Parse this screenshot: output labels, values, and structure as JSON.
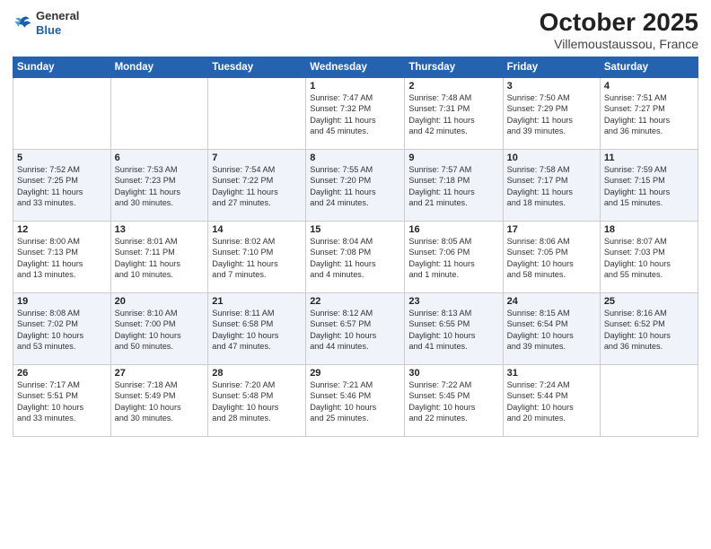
{
  "logo": {
    "general": "General",
    "blue": "Blue"
  },
  "title": "October 2025",
  "location": "Villemoustaussou, France",
  "headers": [
    "Sunday",
    "Monday",
    "Tuesday",
    "Wednesday",
    "Thursday",
    "Friday",
    "Saturday"
  ],
  "weeks": [
    [
      {
        "day": "",
        "info": ""
      },
      {
        "day": "",
        "info": ""
      },
      {
        "day": "",
        "info": ""
      },
      {
        "day": "1",
        "info": "Sunrise: 7:47 AM\nSunset: 7:32 PM\nDaylight: 11 hours\nand 45 minutes."
      },
      {
        "day": "2",
        "info": "Sunrise: 7:48 AM\nSunset: 7:31 PM\nDaylight: 11 hours\nand 42 minutes."
      },
      {
        "day": "3",
        "info": "Sunrise: 7:50 AM\nSunset: 7:29 PM\nDaylight: 11 hours\nand 39 minutes."
      },
      {
        "day": "4",
        "info": "Sunrise: 7:51 AM\nSunset: 7:27 PM\nDaylight: 11 hours\nand 36 minutes."
      }
    ],
    [
      {
        "day": "5",
        "info": "Sunrise: 7:52 AM\nSunset: 7:25 PM\nDaylight: 11 hours\nand 33 minutes."
      },
      {
        "day": "6",
        "info": "Sunrise: 7:53 AM\nSunset: 7:23 PM\nDaylight: 11 hours\nand 30 minutes."
      },
      {
        "day": "7",
        "info": "Sunrise: 7:54 AM\nSunset: 7:22 PM\nDaylight: 11 hours\nand 27 minutes."
      },
      {
        "day": "8",
        "info": "Sunrise: 7:55 AM\nSunset: 7:20 PM\nDaylight: 11 hours\nand 24 minutes."
      },
      {
        "day": "9",
        "info": "Sunrise: 7:57 AM\nSunset: 7:18 PM\nDaylight: 11 hours\nand 21 minutes."
      },
      {
        "day": "10",
        "info": "Sunrise: 7:58 AM\nSunset: 7:17 PM\nDaylight: 11 hours\nand 18 minutes."
      },
      {
        "day": "11",
        "info": "Sunrise: 7:59 AM\nSunset: 7:15 PM\nDaylight: 11 hours\nand 15 minutes."
      }
    ],
    [
      {
        "day": "12",
        "info": "Sunrise: 8:00 AM\nSunset: 7:13 PM\nDaylight: 11 hours\nand 13 minutes."
      },
      {
        "day": "13",
        "info": "Sunrise: 8:01 AM\nSunset: 7:11 PM\nDaylight: 11 hours\nand 10 minutes."
      },
      {
        "day": "14",
        "info": "Sunrise: 8:02 AM\nSunset: 7:10 PM\nDaylight: 11 hours\nand 7 minutes."
      },
      {
        "day": "15",
        "info": "Sunrise: 8:04 AM\nSunset: 7:08 PM\nDaylight: 11 hours\nand 4 minutes."
      },
      {
        "day": "16",
        "info": "Sunrise: 8:05 AM\nSunset: 7:06 PM\nDaylight: 11 hours\nand 1 minute."
      },
      {
        "day": "17",
        "info": "Sunrise: 8:06 AM\nSunset: 7:05 PM\nDaylight: 10 hours\nand 58 minutes."
      },
      {
        "day": "18",
        "info": "Sunrise: 8:07 AM\nSunset: 7:03 PM\nDaylight: 10 hours\nand 55 minutes."
      }
    ],
    [
      {
        "day": "19",
        "info": "Sunrise: 8:08 AM\nSunset: 7:02 PM\nDaylight: 10 hours\nand 53 minutes."
      },
      {
        "day": "20",
        "info": "Sunrise: 8:10 AM\nSunset: 7:00 PM\nDaylight: 10 hours\nand 50 minutes."
      },
      {
        "day": "21",
        "info": "Sunrise: 8:11 AM\nSunset: 6:58 PM\nDaylight: 10 hours\nand 47 minutes."
      },
      {
        "day": "22",
        "info": "Sunrise: 8:12 AM\nSunset: 6:57 PM\nDaylight: 10 hours\nand 44 minutes."
      },
      {
        "day": "23",
        "info": "Sunrise: 8:13 AM\nSunset: 6:55 PM\nDaylight: 10 hours\nand 41 minutes."
      },
      {
        "day": "24",
        "info": "Sunrise: 8:15 AM\nSunset: 6:54 PM\nDaylight: 10 hours\nand 39 minutes."
      },
      {
        "day": "25",
        "info": "Sunrise: 8:16 AM\nSunset: 6:52 PM\nDaylight: 10 hours\nand 36 minutes."
      }
    ],
    [
      {
        "day": "26",
        "info": "Sunrise: 7:17 AM\nSunset: 5:51 PM\nDaylight: 10 hours\nand 33 minutes."
      },
      {
        "day": "27",
        "info": "Sunrise: 7:18 AM\nSunset: 5:49 PM\nDaylight: 10 hours\nand 30 minutes."
      },
      {
        "day": "28",
        "info": "Sunrise: 7:20 AM\nSunset: 5:48 PM\nDaylight: 10 hours\nand 28 minutes."
      },
      {
        "day": "29",
        "info": "Sunrise: 7:21 AM\nSunset: 5:46 PM\nDaylight: 10 hours\nand 25 minutes."
      },
      {
        "day": "30",
        "info": "Sunrise: 7:22 AM\nSunset: 5:45 PM\nDaylight: 10 hours\nand 22 minutes."
      },
      {
        "day": "31",
        "info": "Sunrise: 7:24 AM\nSunset: 5:44 PM\nDaylight: 10 hours\nand 20 minutes."
      },
      {
        "day": "",
        "info": ""
      }
    ]
  ]
}
